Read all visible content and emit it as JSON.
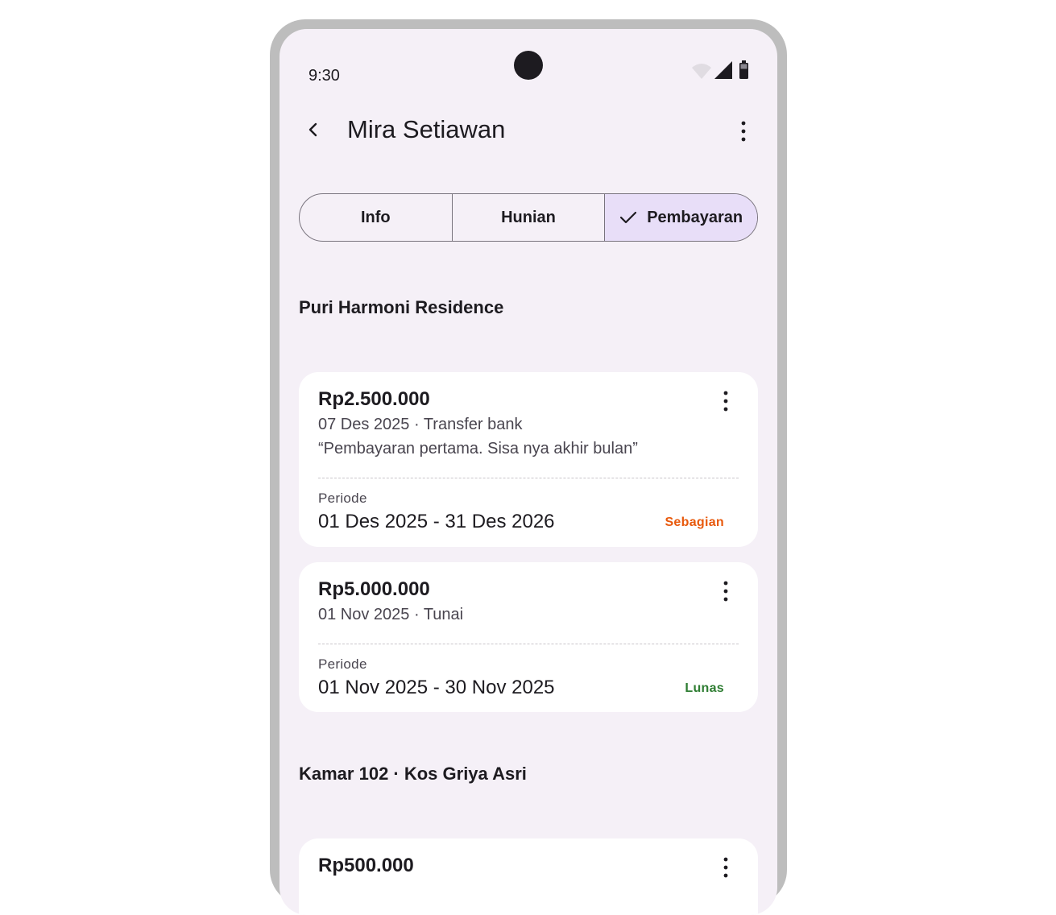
{
  "status_bar": {
    "time": "9:30"
  },
  "app_bar": {
    "title": "Mira Setiawan",
    "back_icon": "arrow-back-icon",
    "more_icon": "more-vert-icon"
  },
  "tabs": [
    {
      "label": "Info",
      "selected": false
    },
    {
      "label": "Hunian",
      "selected": false
    },
    {
      "label": "Pembayaran",
      "selected": true
    }
  ],
  "sections": [
    {
      "title": "Puri Harmoni Residence",
      "payments": [
        {
          "amount": "Rp2.500.000",
          "meta": "07 Des 2025 · Transfer bank",
          "note": "“Pembayaran pertama. Sisa nya akhir bulan”",
          "periode_label": "Periode",
          "periode": "01 Des 2025 - 31 Des 2026",
          "status": "Sebagian",
          "status_color": "#e8590c"
        },
        {
          "amount": "Rp5.000.000",
          "meta": "01 Nov 2025 · Tunai",
          "periode_label": "Periode",
          "periode": "01 Nov 2025 - 30 Nov 2025",
          "status": "Lunas",
          "status_color": "#2e7d32"
        }
      ]
    },
    {
      "title": "Kamar 102 · Kos Griya Asri",
      "payments": [
        {
          "amount": "Rp500.000"
        }
      ]
    }
  ]
}
